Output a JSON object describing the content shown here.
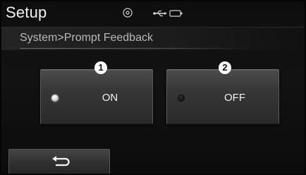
{
  "header": {
    "title": "Setup",
    "status_icons": [
      "disc-icon",
      "usb-icon",
      "battery-icon"
    ]
  },
  "breadcrumb": {
    "text": "System>Prompt Feedback"
  },
  "options": [
    {
      "label": "ON",
      "selected": true,
      "callout": "1"
    },
    {
      "label": "OFF",
      "selected": false,
      "callout": "2"
    }
  ],
  "footer": {
    "back_icon": "back-arrow-icon"
  },
  "colors": {
    "background": "#121212",
    "text": "#f2f2f2",
    "led_active": "#d8d8d8",
    "led_inactive": "#141414"
  }
}
